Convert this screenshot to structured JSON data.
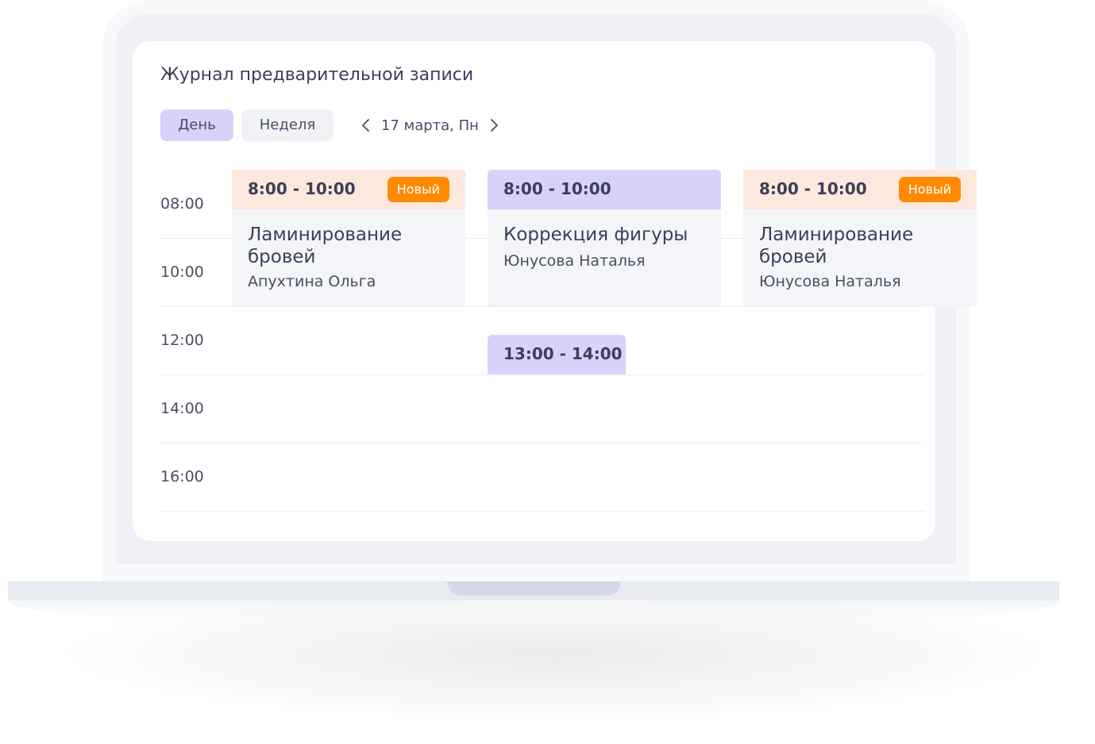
{
  "journal": {
    "title": "Журнал предварительной записи",
    "tabs": {
      "day": "День",
      "week": "Неделя"
    },
    "date": "17 марта, Пн",
    "time_labels": [
      "08:00",
      "10:00",
      "12:00",
      "14:00",
      "16:00"
    ],
    "events": [
      {
        "time": "8:00 - 10:00",
        "badge": "Новый",
        "service": "Ламинирование бровей",
        "client": "Апухтина Ольга",
        "status_color": "#fde8dd"
      },
      {
        "time": "8:00 - 10:00",
        "service": "Коррекция фигуры",
        "client": "Юнусова Наталья",
        "status_color": "#d8d2fb"
      },
      {
        "time": "8:00 - 10:00",
        "badge": "Новый",
        "service": "Ламинирование бровей",
        "client": "Юнусова Наталья",
        "status_color": "#fde8dd"
      },
      {
        "time": "13:00 - 14:00",
        "status_color": "#d8d2fb"
      }
    ]
  },
  "colors": {
    "accent_purple": "#d8d2fb",
    "badge_orange": "#ff8a00",
    "new_header": "#fde8dd"
  }
}
